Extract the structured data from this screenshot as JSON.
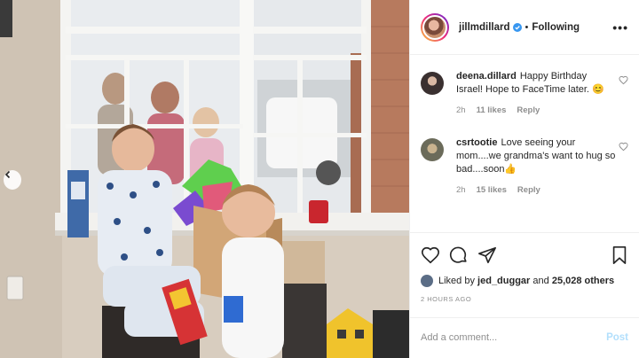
{
  "post": {
    "username": "jillmdillard",
    "separator": "•",
    "follow_status": "Following",
    "more_label": "•••"
  },
  "comments": [
    {
      "username": "deena.dillard",
      "text": "Happy Birthday Israel! Hope to FaceTime later. 😊",
      "age": "2h",
      "likes": "11 likes",
      "reply": "Reply",
      "avatar_color": "#3a3030"
    },
    {
      "username": "csrtootie",
      "text": "Love seeing your mom....we grandma's want to hug so bad....soon👍",
      "age": "2h",
      "likes": "15 likes",
      "reply": "Reply",
      "avatar_color": "#8a8a6a"
    }
  ],
  "likes": {
    "prefix": "Liked by",
    "user": "jed_duggar",
    "conjunction": "and",
    "count": "25,028 others"
  },
  "timestamp": "2 HOURS AGO",
  "comment_box": {
    "placeholder": "Add a comment...",
    "post_label": "Post"
  },
  "colors": {
    "verified_blue": "#3897f0",
    "post_button_disabled": "#b2dffc",
    "meta_gray": "#8e8e8e"
  }
}
